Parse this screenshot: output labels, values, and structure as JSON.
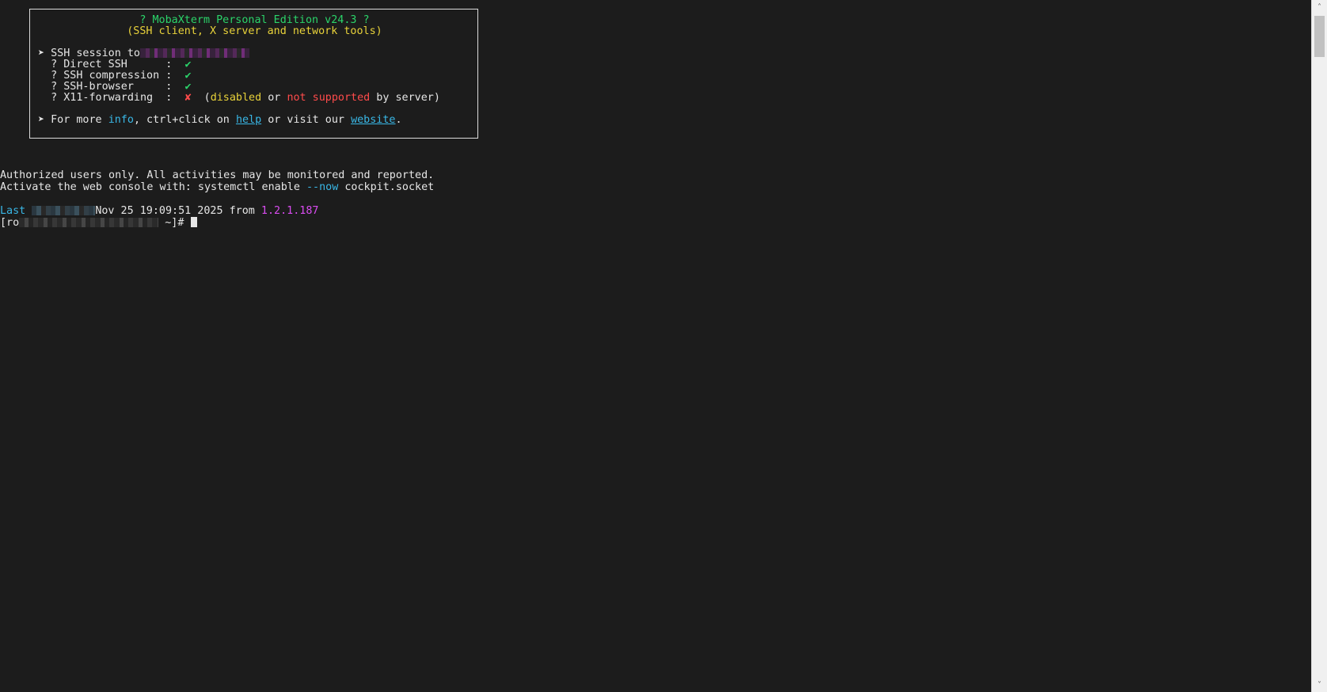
{
  "banner": {
    "title": "? MobaXterm Personal Edition v24.3 ?",
    "subtitle": "(SSH client, X server and network tools)",
    "session_prefix": "➤ SSH session to",
    "rows": [
      {
        "label": "  ? Direct SSH      :  ",
        "mark": "✔"
      },
      {
        "label": "  ? SSH compression :  ",
        "mark": "✔"
      },
      {
        "label": "  ? SSH-browser     :  ",
        "mark": "✔"
      }
    ],
    "x11_label": "  ? X11-forwarding  :  ",
    "x11_mark": "✘",
    "x11_open": "  (",
    "x11_disabled": "disabled",
    "x11_or": " or ",
    "x11_not_supported": "not supported",
    "x11_tail": " by server)",
    "info_prefix": "➤ For more ",
    "info_word": "info",
    "info_mid": ", ctrl+click on ",
    "help_link": "help",
    "info_mid2": " or visit our ",
    "website_link": "website",
    "info_end": "."
  },
  "motd": {
    "line1": "Authorized users only. All activities may be monitored and reported.",
    "line2_prefix": "Activate the web console with: systemctl enable ",
    "line2_flag": "--now",
    "line2_suffix": " cockpit.socket"
  },
  "last_login": {
    "prefix": "Last ",
    "date": "Nov 25 19:09:51 2025 from ",
    "ip": "1.2.1.187"
  },
  "prompt": {
    "prefix": "[ro",
    "suffix": " ~]# "
  },
  "scrollbar": {
    "up_icon": "chevron-up",
    "down_icon": "chevron-down",
    "up_glyph": "˄",
    "down_glyph": "˅"
  }
}
